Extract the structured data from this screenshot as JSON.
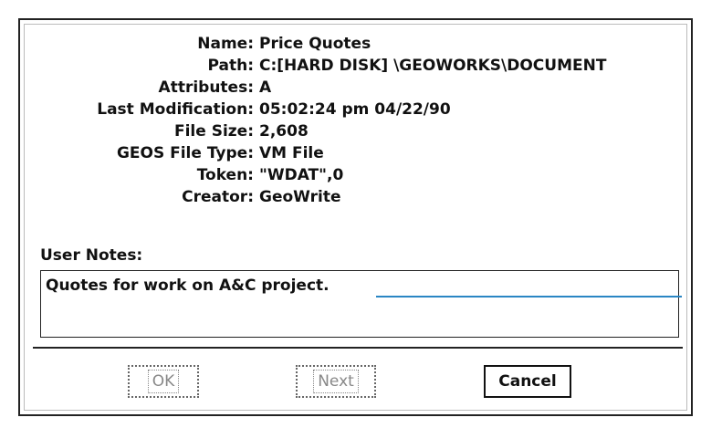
{
  "file_info": {
    "rows": [
      {
        "label": "Name:",
        "value": "Price Quotes"
      },
      {
        "label": "Path:",
        "value": "C:[HARD DISK] \\GEOWORKS\\DOCUMENT"
      },
      {
        "label": "Attributes:",
        "value": "A"
      },
      {
        "label": "Last Modification:",
        "value": "05:02:24 pm  04/22/90"
      },
      {
        "label": "File Size:",
        "value": "2,608"
      },
      {
        "label": "GEOS File Type:",
        "value": "VM File"
      },
      {
        "label": "Token:",
        "value": "\"WDAT\",0"
      },
      {
        "label": "Creator:",
        "value": "GeoWrite"
      }
    ]
  },
  "notes": {
    "label": "User Notes:",
    "text": "Quotes for work on A&C project."
  },
  "buttons": {
    "ok": "OK",
    "next": "Next",
    "cancel": "Cancel"
  },
  "colors": {
    "pointer_line": "#2a86c4"
  }
}
